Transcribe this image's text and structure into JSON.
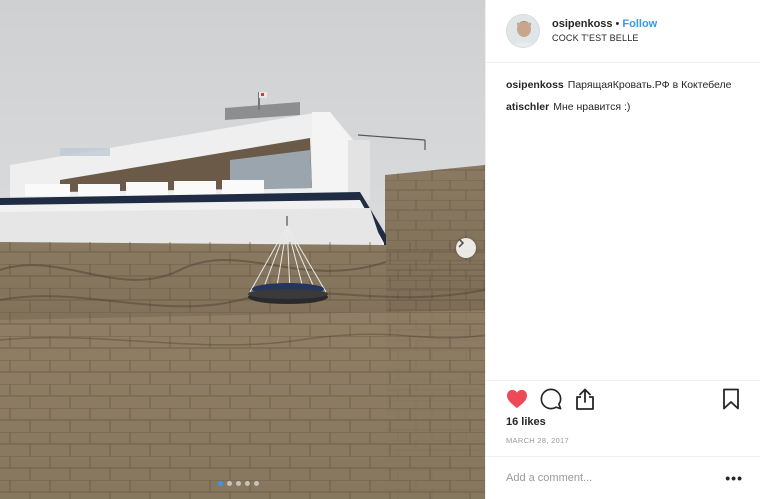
{
  "post": {
    "username": "osipenkoss",
    "separator": "•",
    "follow_label": "Follow",
    "location": "COCK T'EST BELLE"
  },
  "comments": [
    {
      "user": "osipenkoss",
      "text": "ПарящаяКровать.РФ в Коктебеле"
    },
    {
      "user": "atischler",
      "text": "Мне нравится :)"
    }
  ],
  "likes": "16 likes",
  "date": "MARCH 28, 2017",
  "comment_box": {
    "placeholder": "Add a comment..."
  },
  "more_label": "•••",
  "carousel": {
    "slide_count": 5,
    "active_index": 0
  },
  "icons": {
    "like": "heart-icon",
    "comment": "comment-bubble-icon",
    "share": "share-icon",
    "save": "bookmark-icon",
    "next": "chevron-right-icon"
  },
  "colors": {
    "accent": "#3897f0",
    "like": "#ed4956",
    "muted": "#999999"
  }
}
